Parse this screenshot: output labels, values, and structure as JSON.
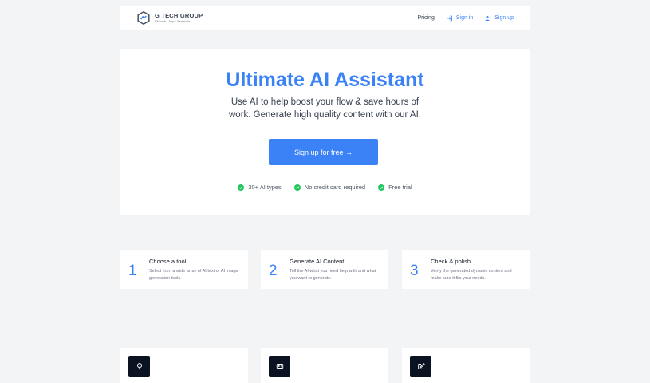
{
  "header": {
    "brand_name": "G TECH GROUP",
    "brand_tagline": "EN web · App · Assistant",
    "nav": {
      "pricing": "Pricing",
      "sign_in": "Sign in",
      "sign_up": "Sign up"
    }
  },
  "hero": {
    "title": "Ultimate AI Assistant",
    "subtitle_line1": "Use AI to help boost your flow & save hours of",
    "subtitle_line2": "work. Generate high quality content with our AI.",
    "cta_label": "Sign up for free →",
    "features": [
      "30+ AI types",
      "No credit card required",
      "Free trial"
    ]
  },
  "steps": [
    {
      "number": "1",
      "title": "Choose a tool",
      "desc": "Select from a wide array of AI text or AI image generation tools."
    },
    {
      "number": "2",
      "title": "Generate AI Content",
      "desc": "Tell the AI what you need help with and what you want to generate."
    },
    {
      "number": "3",
      "title": "Check & polish",
      "desc": "Verify the generated dynamic content and make sure it fits your needs."
    }
  ],
  "bottom_cards": [
    {
      "icon": "lightbulb-icon"
    },
    {
      "icon": "id-card-icon"
    },
    {
      "icon": "edit-icon"
    }
  ],
  "colors": {
    "accent": "#3b82f6",
    "success": "#22c55e",
    "background": "#f3f4f6",
    "icon_bg": "#0b1222"
  }
}
